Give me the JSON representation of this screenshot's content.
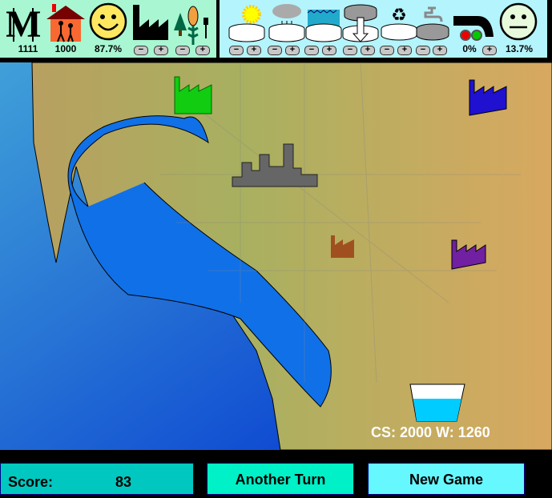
{
  "stats": {
    "money": "1111",
    "population": "1000",
    "happiness": "87.7%",
    "leak_rate": "0%",
    "dissatisfaction": "13.7%"
  },
  "icons": [
    "money-icon",
    "house-icon",
    "smiley-icon",
    "factory-icon",
    "farm-icon",
    "sun-reservoir-icon",
    "rain-reservoir-icon",
    "ocean-desal-icon",
    "groundwater-icon",
    "recycle-icon",
    "tap-icon",
    "leaky-pipe-icon",
    "neutral-face-icon"
  ],
  "controls": {
    "minus": "−",
    "plus": "+"
  },
  "map": {
    "capacity_readout": "CS: 2000 W: 1260"
  },
  "footer": {
    "score_label": "Score:",
    "score_value": "83",
    "another_turn": "Another Turn",
    "new_game": "New Game"
  },
  "colors": {
    "left_panel": "#a8f7d2",
    "right_panel": "#b4f4fc",
    "score_bg": "#00c8c0",
    "turn_bg": "#00f0c8",
    "newgame_bg": "#66f8ff",
    "water": "#1070e8"
  }
}
